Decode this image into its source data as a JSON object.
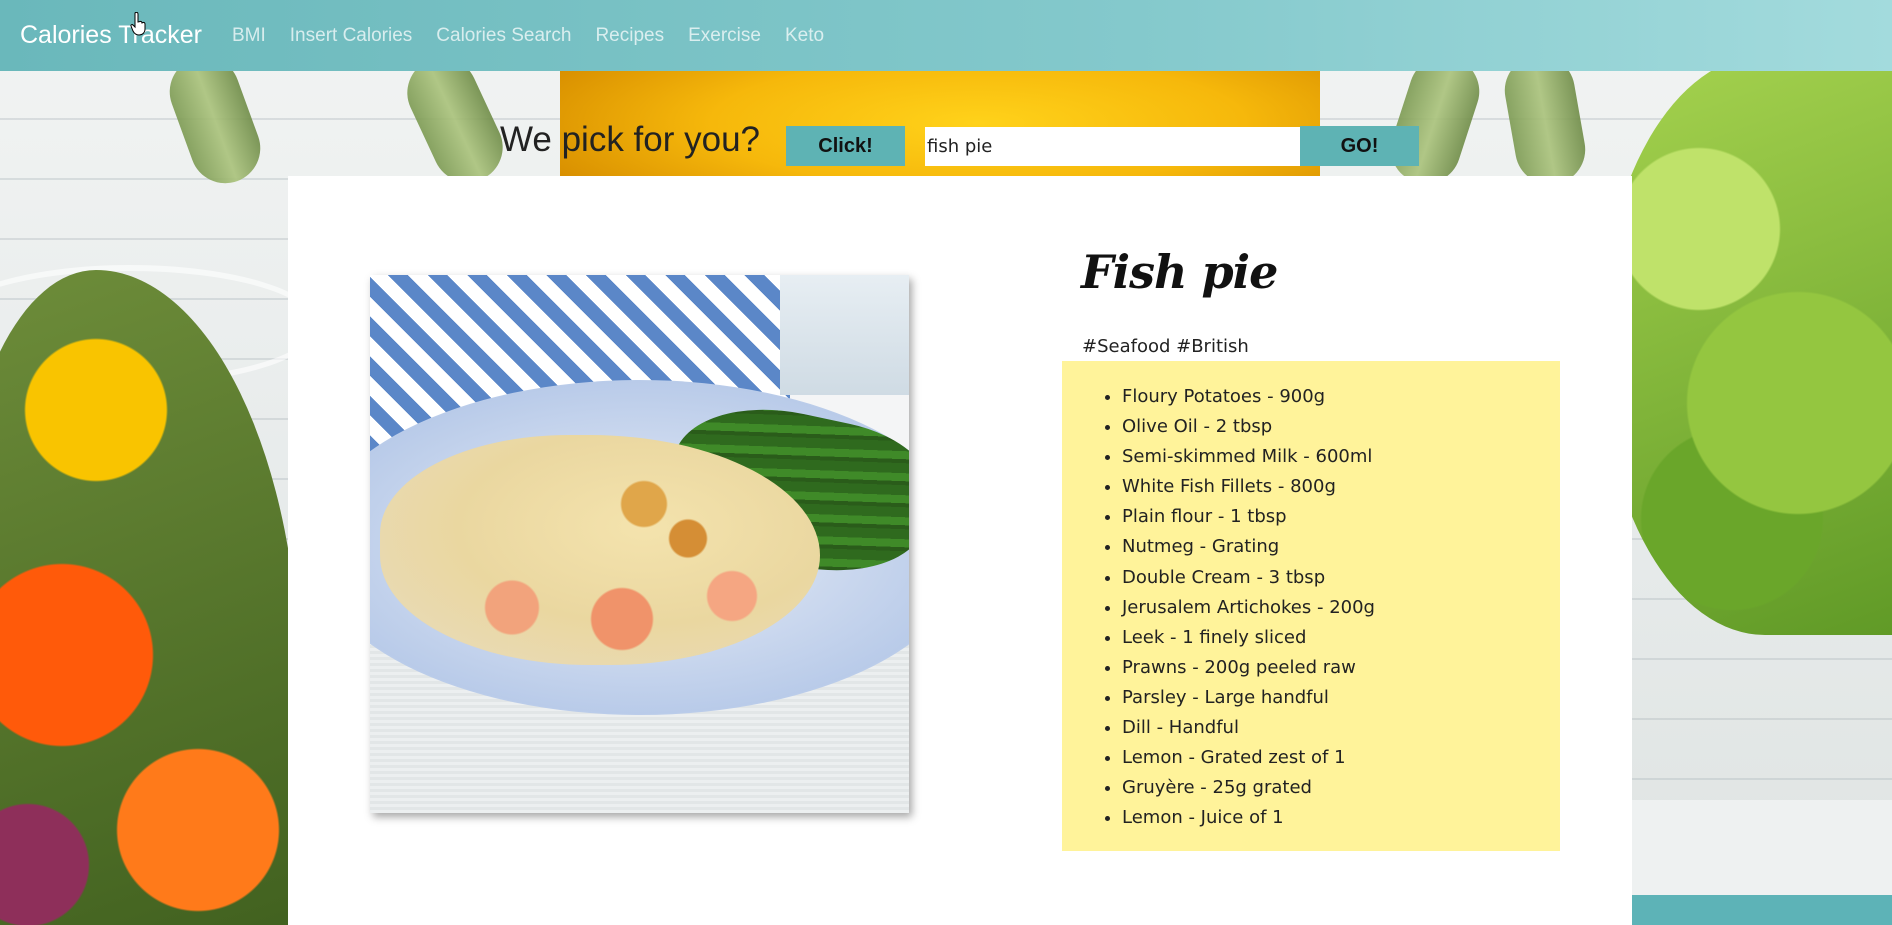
{
  "navbar": {
    "brand": "Calories Tracker",
    "links": [
      "BMI",
      "Insert Calories",
      "Calories Search",
      "Recipes",
      "Exercise",
      "Keto"
    ]
  },
  "search": {
    "prompt": "We pick for you?",
    "random_button": "Click!",
    "query": "fish pie",
    "go_button": "GO!"
  },
  "recipe": {
    "title": "Fish pie",
    "tags": "#Seafood #British",
    "ingredients": [
      "Floury Potatoes - 900g",
      "Olive Oil - 2 tbsp",
      "Semi-skimmed Milk - 600ml",
      "White Fish Fillets - 800g",
      "Plain flour - 1 tbsp",
      "Nutmeg - Grating",
      "Double Cream - 3 tbsp",
      "Jerusalem Artichokes - 200g",
      "Leek - 1 finely sliced",
      "Prawns - 200g peeled raw",
      "Parsley - Large handful",
      "Dill - Handful",
      "Lemon - Grated zest of 1",
      "Gruyère - 25g grated",
      "Lemon - Juice of 1"
    ]
  },
  "colors": {
    "navbar": "#6ab8bb",
    "button": "#5eb3b4",
    "ingredients_bg": "#fff39a"
  }
}
